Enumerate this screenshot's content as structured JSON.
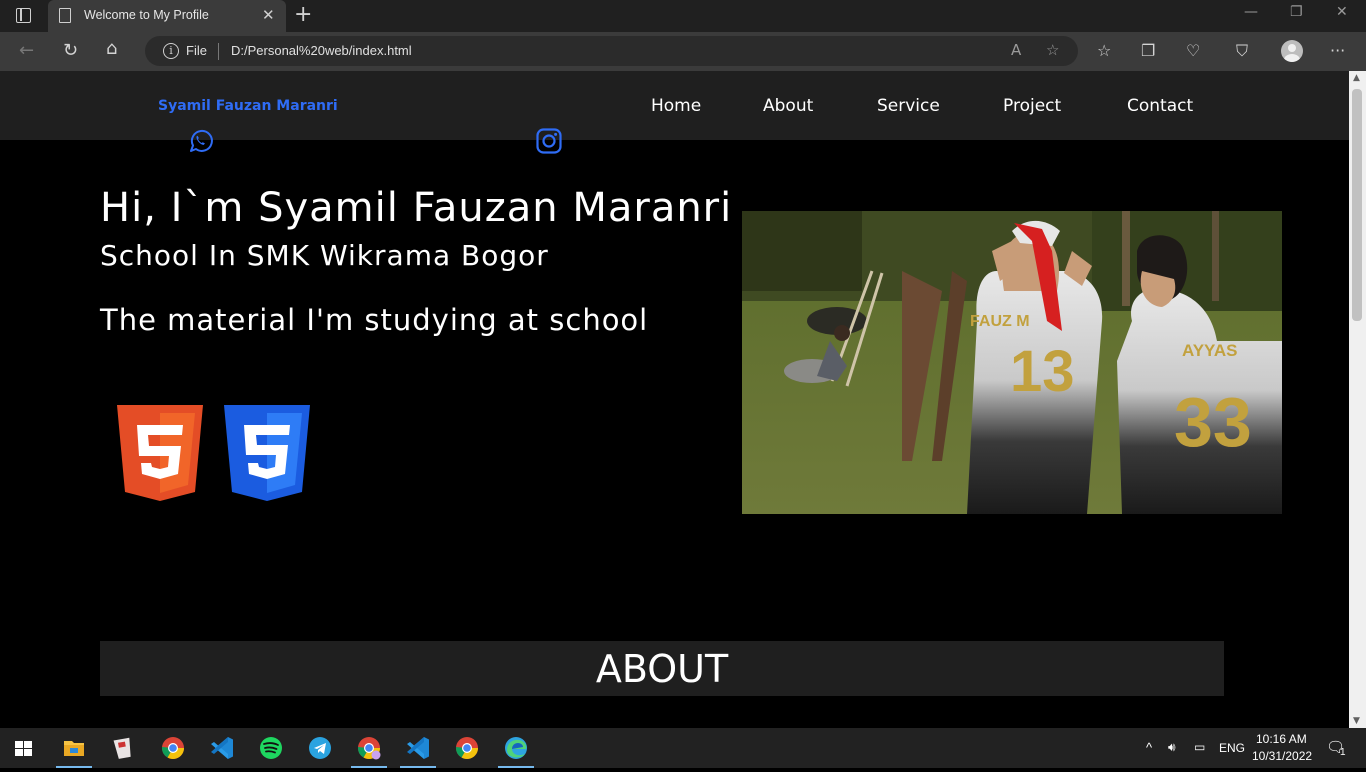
{
  "browser": {
    "tab_title": "Welcome to My Profile",
    "tab_close": "✕",
    "new_tab": "+",
    "address_prefix": "File",
    "url": "D:/Personal%20web/index.html",
    "window_controls": {
      "minimize": "—",
      "restore": "❐",
      "close": "✕"
    }
  },
  "site": {
    "brand": "Syamil Fauzan Maranri",
    "nav": [
      "Home",
      "About",
      "Service",
      "Project",
      "Contact"
    ],
    "social": {
      "whatsapp": "whatsapp-icon",
      "instagram": "instagram-icon",
      "color": "#2f6cf5"
    },
    "hero": {
      "title": "Hi, I`m Syamil Fauzan Maranri",
      "subtitle": "School In SMK Wikrama Bogor",
      "material": "The material I'm studying at school"
    },
    "tech_logos": [
      "html5-logo",
      "css3-logo"
    ],
    "about_heading": "ABOUT"
  },
  "taskbar": {
    "apps": [
      "file-explorer",
      "app-2",
      "chrome",
      "vscode",
      "spotify",
      "telegram",
      "chrome-profile",
      "vscode-2",
      "chrome-2",
      "edge"
    ],
    "lang": "ENG",
    "time": "10:16 AM",
    "date": "10/31/2022",
    "notifications": "1"
  },
  "colors": {
    "accent": "#2f6cf5",
    "header_bg": "#1f1f1f",
    "page_bg": "#000000"
  }
}
